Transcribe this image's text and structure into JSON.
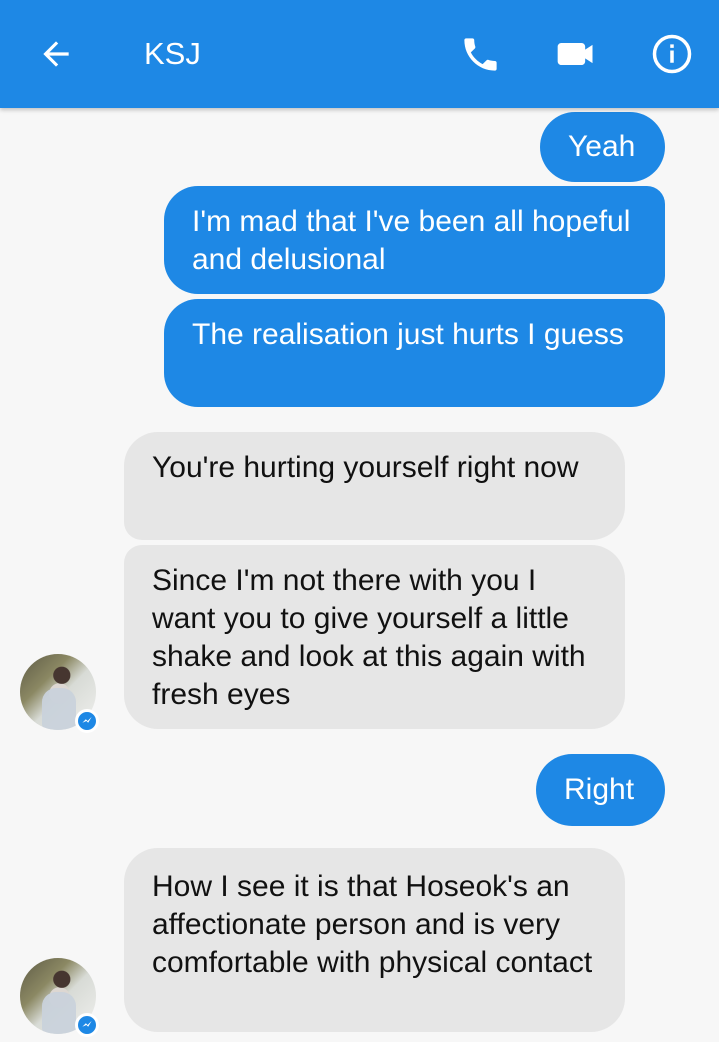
{
  "header": {
    "back_icon": "arrow-left-icon",
    "title": "KSJ",
    "actions": [
      {
        "name": "phone-call-icon"
      },
      {
        "name": "video-call-icon"
      },
      {
        "name": "info-icon"
      }
    ]
  },
  "messages": [
    {
      "sender": "me",
      "text": "Yeah"
    },
    {
      "sender": "me",
      "text": "I'm mad that I've been all hopeful and delusional"
    },
    {
      "sender": "me",
      "text": "The realisation just hurts I guess"
    },
    {
      "sender": "them",
      "text": "You're hurting yourself right now"
    },
    {
      "sender": "them",
      "text": "Since I'm not there with you I want you to give yourself a little shake and look at this again with fresh eyes"
    },
    {
      "sender": "me",
      "text": "Right"
    },
    {
      "sender": "them",
      "text": "How I see it is that Hoseok's an affectionate person and is very comfortable with physical contact"
    }
  ],
  "colors": {
    "header": "#1e88e5",
    "outgoing_bubble": "#1e88e5",
    "incoming_bubble": "#e6e6e6",
    "background": "#f7f7f7",
    "messenger_badge": "#1e88e5"
  }
}
